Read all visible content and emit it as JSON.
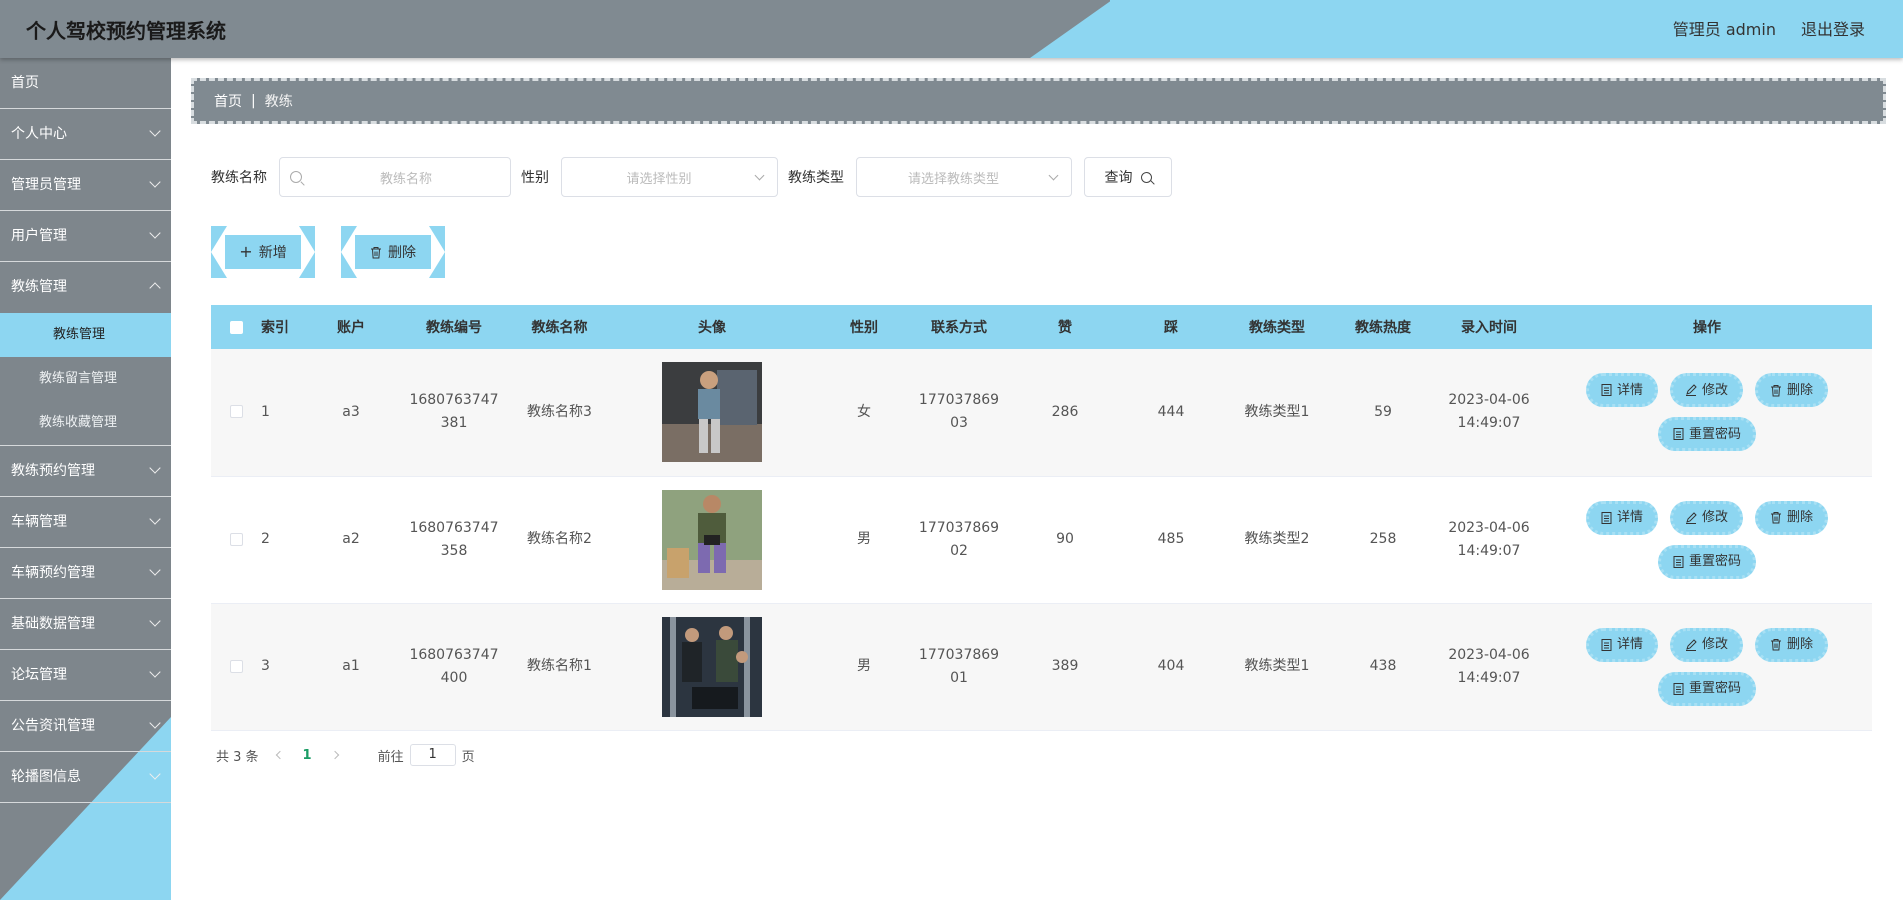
{
  "app": {
    "title": "个人驾校预约管理系统"
  },
  "header": {
    "user": "管理员 admin",
    "logout": "退出登录"
  },
  "sidebar": {
    "items": [
      {
        "label": "首页",
        "chevron": false
      },
      {
        "label": "个人中心",
        "chevron": true
      },
      {
        "label": "管理员管理",
        "chevron": true
      },
      {
        "label": "用户管理",
        "chevron": true
      },
      {
        "label": "教练管理",
        "chevron": true,
        "expanded": true,
        "children": [
          {
            "label": "教练管理",
            "active": true
          },
          {
            "label": "教练留言管理"
          },
          {
            "label": "教练收藏管理"
          }
        ]
      },
      {
        "label": "教练预约管理",
        "chevron": true
      },
      {
        "label": "车辆管理",
        "chevron": true
      },
      {
        "label": "车辆预约管理",
        "chevron": true
      },
      {
        "label": "基础数据管理",
        "chevron": true
      },
      {
        "label": "论坛管理",
        "chevron": true
      },
      {
        "label": "公告资讯管理",
        "chevron": true
      },
      {
        "label": "轮播图信息",
        "chevron": true
      }
    ]
  },
  "breadcrumb": {
    "home": "首页",
    "separator": "|",
    "current": "教练"
  },
  "search": {
    "name_label": "教练名称",
    "name_placeholder": "教练名称",
    "gender_label": "性别",
    "gender_placeholder": "请选择性别",
    "type_label": "教练类型",
    "type_placeholder": "请选择教练类型",
    "query_button": "查询"
  },
  "actions": {
    "add": "新增",
    "delete": "删除"
  },
  "table": {
    "headers": [
      "索引",
      "账户",
      "教练编号",
      "教练名称",
      "头像",
      "性别",
      "联系方式",
      "赞",
      "踩",
      "教练类型",
      "教练热度",
      "录入时间",
      "操作"
    ],
    "rows": [
      {
        "index": "1",
        "account": "a3",
        "code": "1680763747381",
        "name": "教练名称3",
        "gender": "女",
        "phone": "17703786903",
        "likes": "286",
        "dislikes": "444",
        "type": "教练类型1",
        "heat": "59",
        "time": "2023-04-06 14:49:07"
      },
      {
        "index": "2",
        "account": "a2",
        "code": "1680763747358",
        "name": "教练名称2",
        "gender": "男",
        "phone": "17703786902",
        "likes": "90",
        "dislikes": "485",
        "type": "教练类型2",
        "heat": "258",
        "time": "2023-04-06 14:49:07"
      },
      {
        "index": "3",
        "account": "a1",
        "code": "1680763747400",
        "name": "教练名称1",
        "gender": "男",
        "phone": "17703786901",
        "likes": "389",
        "dislikes": "404",
        "type": "教练类型1",
        "heat": "438",
        "time": "2023-04-06 14:49:07"
      }
    ],
    "row_actions": {
      "detail": "详情",
      "edit": "修改",
      "delete": "删除",
      "reset": "重置密码"
    }
  },
  "pagination": {
    "total": "共 3 条",
    "current_page": "1",
    "goto_prefix": "前往",
    "goto_value": "1",
    "goto_suffix": "页"
  },
  "colors": {
    "accent": "#8dd6f1",
    "header_bg": "#808a91",
    "sidebar_bg": "#7e868c",
    "page_active": "#1a9c64"
  }
}
